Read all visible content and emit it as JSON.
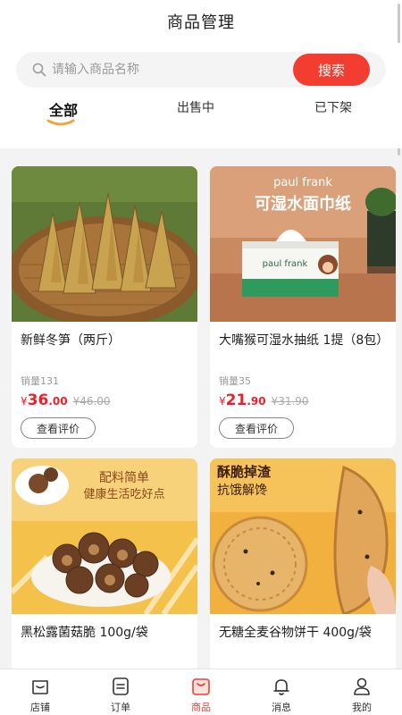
{
  "header": {
    "title": "商品管理"
  },
  "search": {
    "placeholder": "请输入商品名称",
    "value": "",
    "button_label": "搜索"
  },
  "tabs": [
    {
      "label": "全部",
      "active": true
    },
    {
      "label": "出售中",
      "active": false
    },
    {
      "label": "已下架",
      "active": false
    }
  ],
  "products": [
    {
      "name": "新鲜冬笋（两斤）",
      "sales": "销量131",
      "price_symbol": "¥",
      "price_int": "36",
      "price_dec": ".00",
      "original_price": "¥46.00",
      "review_label": "查看评价"
    },
    {
      "name": "大嘴猴可湿水抽纸 1提（8包）",
      "sales": "销量35",
      "price_symbol": "¥",
      "price_int": "21",
      "price_dec": ".90",
      "original_price": "¥31.90",
      "review_label": "查看评价",
      "image_text": {
        "brand": "paul frank",
        "headline": "可湿水面巾纸",
        "pack_brand": "paul frank"
      }
    },
    {
      "name": "黑松露菌菇脆 100g/袋",
      "image_text": {
        "line1": "配料简单",
        "line2": "健康生活吃好点"
      }
    },
    {
      "name": "无糖全麦谷物饼干 400g/袋",
      "image_text": {
        "line1": "酥脆掉渣",
        "line2": "抗饿解馋"
      }
    }
  ],
  "nav": [
    {
      "label": "店铺",
      "icon": "store-icon",
      "active": false
    },
    {
      "label": "订单",
      "icon": "order-icon",
      "active": false
    },
    {
      "label": "商品",
      "icon": "product-icon",
      "active": true
    },
    {
      "label": "消息",
      "icon": "bell-icon",
      "active": false
    },
    {
      "label": "我的",
      "icon": "user-icon",
      "active": false
    }
  ],
  "colors": {
    "accent": "#f23d30",
    "price": "#e8212c",
    "background": "#f3f3f3"
  }
}
